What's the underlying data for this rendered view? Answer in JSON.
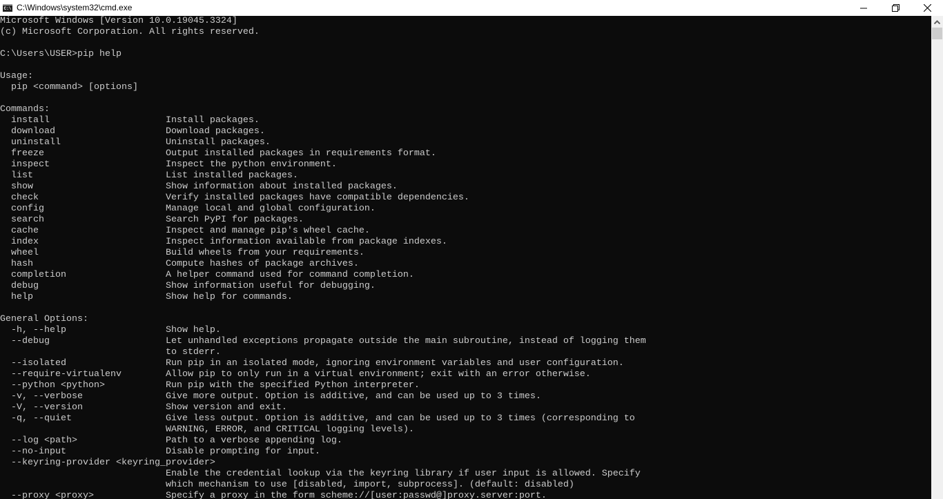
{
  "window": {
    "title": "C:\\Windows\\system32\\cmd.exe",
    "icon": "cmd-icon",
    "icon_text": "C:\\"
  },
  "colors": {
    "background": "#0c0c0c",
    "text": "#cccccc"
  },
  "terminal": {
    "lines": [
      "Microsoft Windows [Version 10.0.19045.3324]",
      "(c) Microsoft Corporation. All rights reserved.",
      "",
      "C:\\Users\\USER>pip help",
      "",
      "Usage:",
      "  pip <command> [options]",
      "",
      "Commands:",
      "  install                     Install packages.",
      "  download                    Download packages.",
      "  uninstall                   Uninstall packages.",
      "  freeze                      Output installed packages in requirements format.",
      "  inspect                     Inspect the python environment.",
      "  list                        List installed packages.",
      "  show                        Show information about installed packages.",
      "  check                       Verify installed packages have compatible dependencies.",
      "  config                      Manage local and global configuration.",
      "  search                      Search PyPI for packages.",
      "  cache                       Inspect and manage pip's wheel cache.",
      "  index                       Inspect information available from package indexes.",
      "  wheel                       Build wheels from your requirements.",
      "  hash                        Compute hashes of package archives.",
      "  completion                  A helper command used for command completion.",
      "  debug                       Show information useful for debugging.",
      "  help                        Show help for commands.",
      "",
      "General Options:",
      "  -h, --help                  Show help.",
      "  --debug                     Let unhandled exceptions propagate outside the main subroutine, instead of logging them",
      "                              to stderr.",
      "  --isolated                  Run pip in an isolated mode, ignoring environment variables and user configuration.",
      "  --require-virtualenv        Allow pip to only run in a virtual environment; exit with an error otherwise.",
      "  --python <python>           Run pip with the specified Python interpreter.",
      "  -v, --verbose               Give more output. Option is additive, and can be used up to 3 times.",
      "  -V, --version               Show version and exit.",
      "  -q, --quiet                 Give less output. Option is additive, and can be used up to 3 times (corresponding to",
      "                              WARNING, ERROR, and CRITICAL logging levels).",
      "  --log <path>                Path to a verbose appending log.",
      "  --no-input                  Disable prompting for input.",
      "  --keyring-provider <keyring_provider>",
      "                              Enable the credential lookup via the keyring library if user input is allowed. Specify",
      "                              which mechanism to use [disabled, import, subprocess]. (default: disabled)",
      "  --proxy <proxy>             Specify a proxy in the form scheme://[user:passwd@]proxy.server:port."
    ]
  }
}
